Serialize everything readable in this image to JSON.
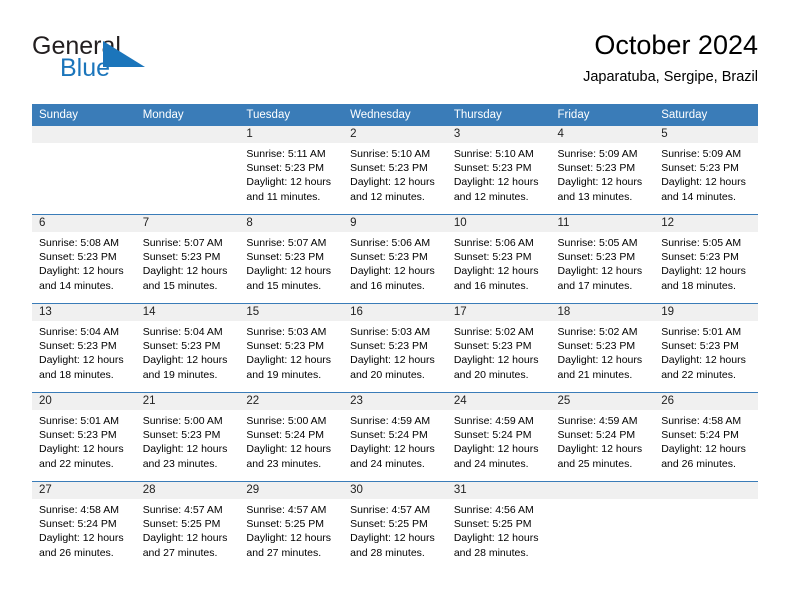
{
  "brand": {
    "name_part1": "General",
    "name_part2": "Blue",
    "mark_icon": "triangle-flag-icon",
    "colors": {
      "general": "#231f20",
      "blue": "#1b75bb",
      "mark": "#1b75bb"
    }
  },
  "header": {
    "title": "October 2024",
    "subtitle": "Japaratuba, Sergipe, Brazil"
  },
  "theme": {
    "header_bg": "#3a7cb8",
    "header_text": "#ffffff",
    "daynum_band_bg": "#f0f0f0",
    "row_divider": "#3a7cb8"
  },
  "weekday_headers": [
    "Sunday",
    "Monday",
    "Tuesday",
    "Wednesday",
    "Thursday",
    "Friday",
    "Saturday"
  ],
  "weeks": [
    [
      {
        "day": "",
        "lines": []
      },
      {
        "day": "",
        "lines": []
      },
      {
        "day": "1",
        "lines": [
          "Sunrise: 5:11 AM",
          "Sunset: 5:23 PM",
          "Daylight: 12 hours",
          "and 11 minutes."
        ]
      },
      {
        "day": "2",
        "lines": [
          "Sunrise: 5:10 AM",
          "Sunset: 5:23 PM",
          "Daylight: 12 hours",
          "and 12 minutes."
        ]
      },
      {
        "day": "3",
        "lines": [
          "Sunrise: 5:10 AM",
          "Sunset: 5:23 PM",
          "Daylight: 12 hours",
          "and 12 minutes."
        ]
      },
      {
        "day": "4",
        "lines": [
          "Sunrise: 5:09 AM",
          "Sunset: 5:23 PM",
          "Daylight: 12 hours",
          "and 13 minutes."
        ]
      },
      {
        "day": "5",
        "lines": [
          "Sunrise: 5:09 AM",
          "Sunset: 5:23 PM",
          "Daylight: 12 hours",
          "and 14 minutes."
        ]
      }
    ],
    [
      {
        "day": "6",
        "lines": [
          "Sunrise: 5:08 AM",
          "Sunset: 5:23 PM",
          "Daylight: 12 hours",
          "and 14 minutes."
        ]
      },
      {
        "day": "7",
        "lines": [
          "Sunrise: 5:07 AM",
          "Sunset: 5:23 PM",
          "Daylight: 12 hours",
          "and 15 minutes."
        ]
      },
      {
        "day": "8",
        "lines": [
          "Sunrise: 5:07 AM",
          "Sunset: 5:23 PM",
          "Daylight: 12 hours",
          "and 15 minutes."
        ]
      },
      {
        "day": "9",
        "lines": [
          "Sunrise: 5:06 AM",
          "Sunset: 5:23 PM",
          "Daylight: 12 hours",
          "and 16 minutes."
        ]
      },
      {
        "day": "10",
        "lines": [
          "Sunrise: 5:06 AM",
          "Sunset: 5:23 PM",
          "Daylight: 12 hours",
          "and 16 minutes."
        ]
      },
      {
        "day": "11",
        "lines": [
          "Sunrise: 5:05 AM",
          "Sunset: 5:23 PM",
          "Daylight: 12 hours",
          "and 17 minutes."
        ]
      },
      {
        "day": "12",
        "lines": [
          "Sunrise: 5:05 AM",
          "Sunset: 5:23 PM",
          "Daylight: 12 hours",
          "and 18 minutes."
        ]
      }
    ],
    [
      {
        "day": "13",
        "lines": [
          "Sunrise: 5:04 AM",
          "Sunset: 5:23 PM",
          "Daylight: 12 hours",
          "and 18 minutes."
        ]
      },
      {
        "day": "14",
        "lines": [
          "Sunrise: 5:04 AM",
          "Sunset: 5:23 PM",
          "Daylight: 12 hours",
          "and 19 minutes."
        ]
      },
      {
        "day": "15",
        "lines": [
          "Sunrise: 5:03 AM",
          "Sunset: 5:23 PM",
          "Daylight: 12 hours",
          "and 19 minutes."
        ]
      },
      {
        "day": "16",
        "lines": [
          "Sunrise: 5:03 AM",
          "Sunset: 5:23 PM",
          "Daylight: 12 hours",
          "and 20 minutes."
        ]
      },
      {
        "day": "17",
        "lines": [
          "Sunrise: 5:02 AM",
          "Sunset: 5:23 PM",
          "Daylight: 12 hours",
          "and 20 minutes."
        ]
      },
      {
        "day": "18",
        "lines": [
          "Sunrise: 5:02 AM",
          "Sunset: 5:23 PM",
          "Daylight: 12 hours",
          "and 21 minutes."
        ]
      },
      {
        "day": "19",
        "lines": [
          "Sunrise: 5:01 AM",
          "Sunset: 5:23 PM",
          "Daylight: 12 hours",
          "and 22 minutes."
        ]
      }
    ],
    [
      {
        "day": "20",
        "lines": [
          "Sunrise: 5:01 AM",
          "Sunset: 5:23 PM",
          "Daylight: 12 hours",
          "and 22 minutes."
        ]
      },
      {
        "day": "21",
        "lines": [
          "Sunrise: 5:00 AM",
          "Sunset: 5:23 PM",
          "Daylight: 12 hours",
          "and 23 minutes."
        ]
      },
      {
        "day": "22",
        "lines": [
          "Sunrise: 5:00 AM",
          "Sunset: 5:24 PM",
          "Daylight: 12 hours",
          "and 23 minutes."
        ]
      },
      {
        "day": "23",
        "lines": [
          "Sunrise: 4:59 AM",
          "Sunset: 5:24 PM",
          "Daylight: 12 hours",
          "and 24 minutes."
        ]
      },
      {
        "day": "24",
        "lines": [
          "Sunrise: 4:59 AM",
          "Sunset: 5:24 PM",
          "Daylight: 12 hours",
          "and 24 minutes."
        ]
      },
      {
        "day": "25",
        "lines": [
          "Sunrise: 4:59 AM",
          "Sunset: 5:24 PM",
          "Daylight: 12 hours",
          "and 25 minutes."
        ]
      },
      {
        "day": "26",
        "lines": [
          "Sunrise: 4:58 AM",
          "Sunset: 5:24 PM",
          "Daylight: 12 hours",
          "and 26 minutes."
        ]
      }
    ],
    [
      {
        "day": "27",
        "lines": [
          "Sunrise: 4:58 AM",
          "Sunset: 5:24 PM",
          "Daylight: 12 hours",
          "and 26 minutes."
        ]
      },
      {
        "day": "28",
        "lines": [
          "Sunrise: 4:57 AM",
          "Sunset: 5:25 PM",
          "Daylight: 12 hours",
          "and 27 minutes."
        ]
      },
      {
        "day": "29",
        "lines": [
          "Sunrise: 4:57 AM",
          "Sunset: 5:25 PM",
          "Daylight: 12 hours",
          "and 27 minutes."
        ]
      },
      {
        "day": "30",
        "lines": [
          "Sunrise: 4:57 AM",
          "Sunset: 5:25 PM",
          "Daylight: 12 hours",
          "and 28 minutes."
        ]
      },
      {
        "day": "31",
        "lines": [
          "Sunrise: 4:56 AM",
          "Sunset: 5:25 PM",
          "Daylight: 12 hours",
          "and 28 minutes."
        ]
      },
      {
        "day": "",
        "lines": []
      },
      {
        "day": "",
        "lines": []
      }
    ]
  ]
}
